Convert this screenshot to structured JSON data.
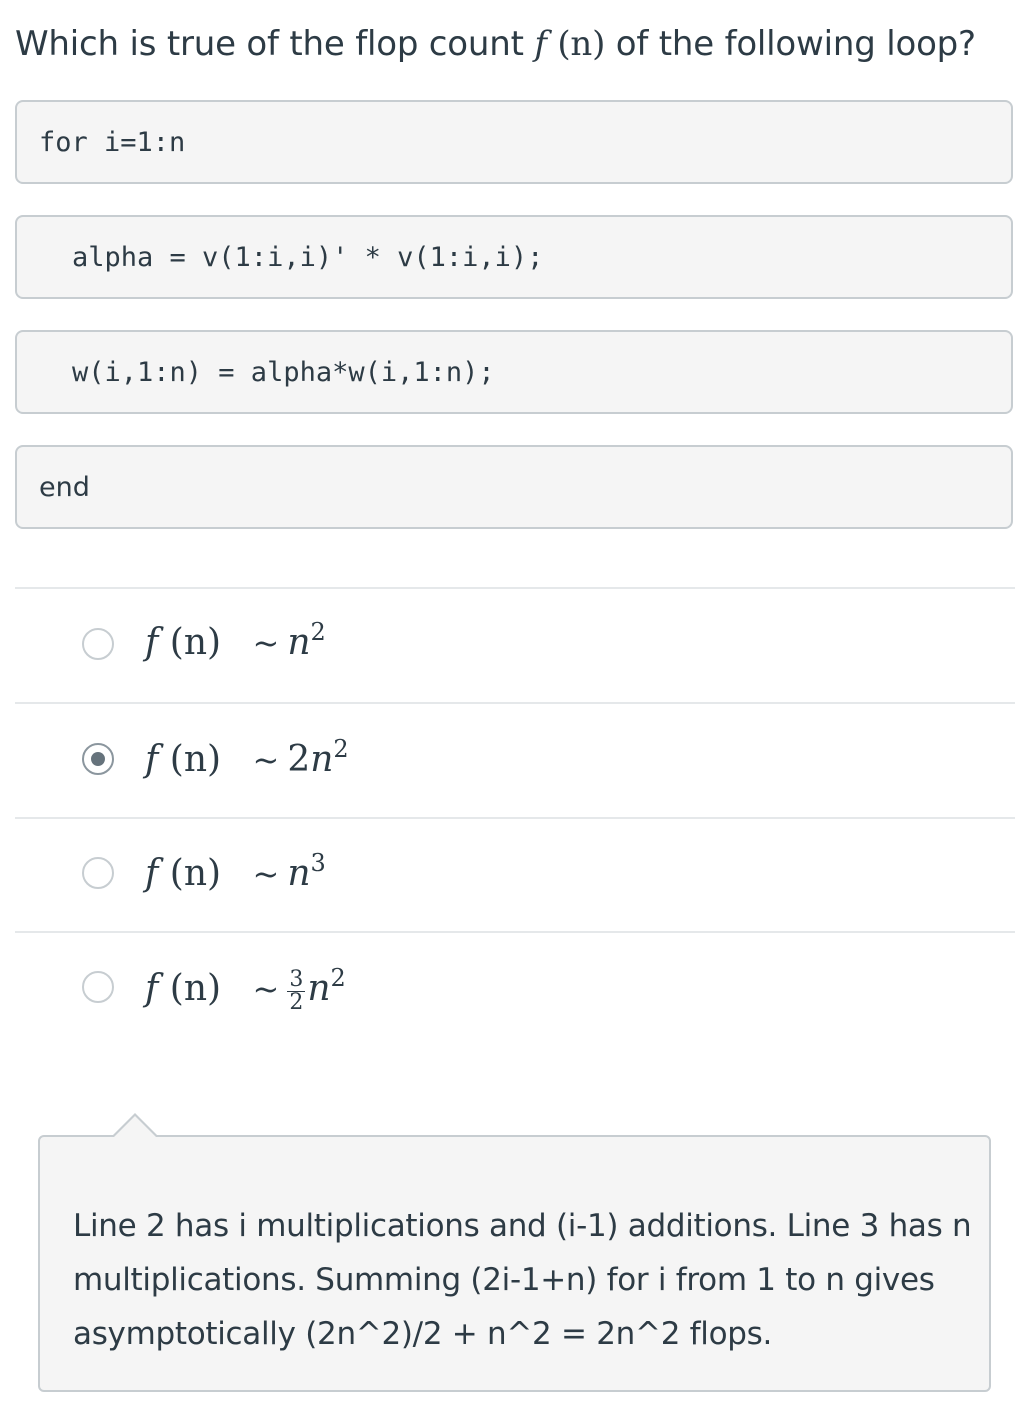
{
  "question": {
    "prefix": "Which is true of the flop count",
    "math_f": "f",
    "math_arg": "(n)",
    "suffix": "of the following loop?"
  },
  "code_lines": [
    {
      "text": "for i=1:n"
    },
    {
      "text": "alpha = v(1:i,i)' * v(1:i,i);"
    },
    {
      "text": "w(i,1:n) = alpha*w(i,1:n);"
    },
    {
      "text": "end"
    }
  ],
  "options": [
    {
      "f": "f",
      "arg": "(n)",
      "tilde": "~",
      "coef": "",
      "base": "n",
      "exp": "2",
      "frac_num": "",
      "frac_den": "",
      "selected": false
    },
    {
      "f": "f",
      "arg": "(n)",
      "tilde": "~",
      "coef": "2",
      "base": "n",
      "exp": "2",
      "frac_num": "",
      "frac_den": "",
      "selected": true
    },
    {
      "f": "f",
      "arg": "(n)",
      "tilde": "~",
      "coef": "",
      "base": "n",
      "exp": "3",
      "frac_num": "",
      "frac_den": "",
      "selected": false
    },
    {
      "f": "f",
      "arg": "(n)",
      "tilde": "~",
      "coef": "",
      "base": "n",
      "exp": "2",
      "frac_num": "3",
      "frac_den": "2",
      "selected": false
    }
  ],
  "feedback": {
    "text": "Line 2 has i multiplications and (i-1) additions. Line 3 has n multiplications. Summing (2i-1+n) for i from 1 to n gives asymptotically (2n^2)/2 + n^2 = 2n^2 flops."
  },
  "colors": {
    "text": "#2d3b45",
    "box_bg": "#f5f5f5",
    "box_border": "#c7cdd1",
    "divider": "#e5e8ea",
    "radio_selected": "#66737c"
  }
}
